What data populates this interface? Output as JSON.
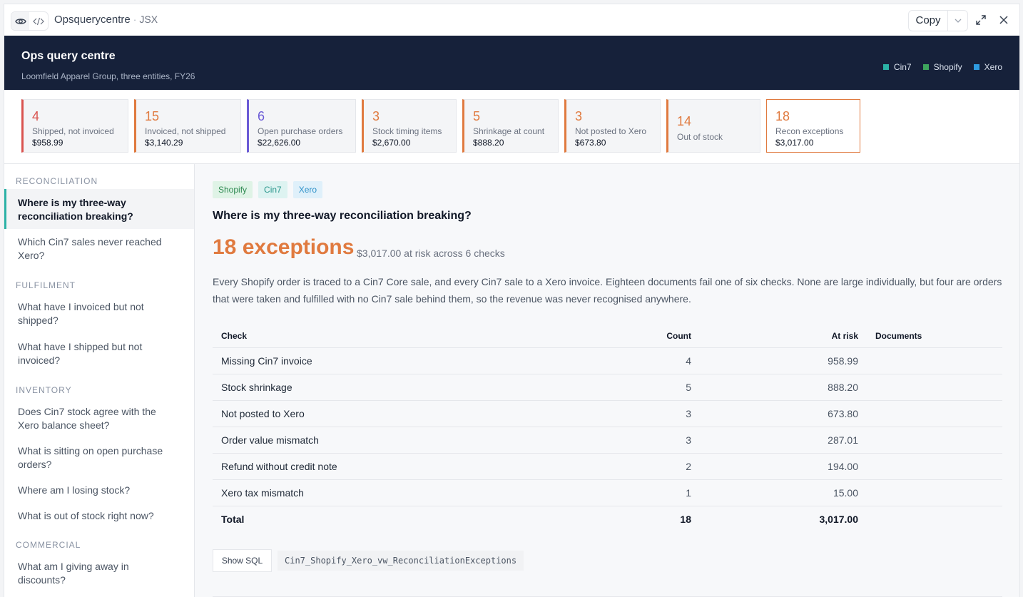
{
  "toolbar": {
    "title": "Opsquerycentre",
    "separator": "·",
    "lang": "JSX",
    "copy_label": "Copy"
  },
  "header": {
    "title": "Ops query centre",
    "subtitle": "Loomfield Apparel Group, three entities, FY26",
    "legend": [
      {
        "label": "Cin7",
        "color": "#2bb2a6"
      },
      {
        "label": "Shopify",
        "color": "#3ea55d"
      },
      {
        "label": "Xero",
        "color": "#2e9be0"
      }
    ]
  },
  "kpis": [
    {
      "count": "4",
      "label": "Shipped, not invoiced",
      "amount": "$958.99",
      "color": "#d9534f"
    },
    {
      "count": "15",
      "label": "Invoiced, not shipped",
      "amount": "$3,140.29",
      "color": "#e07a3f"
    },
    {
      "count": "6",
      "label": "Open purchase orders",
      "amount": "$22,626.00",
      "color": "#6b5bd6"
    },
    {
      "count": "3",
      "label": "Stock timing items",
      "amount": "$2,670.00",
      "color": "#e07a3f"
    },
    {
      "count": "5",
      "label": "Shrinkage at count",
      "amount": "$888.20",
      "color": "#e07a3f"
    },
    {
      "count": "3",
      "label": "Not posted to Xero",
      "amount": "$673.80",
      "color": "#e07a3f"
    },
    {
      "count": "14",
      "label": "Out of stock",
      "amount": "",
      "color": "#e07a3f"
    },
    {
      "count": "18",
      "label": "Recon exceptions",
      "amount": "$3,017.00",
      "color": "#e07a3f"
    }
  ],
  "sidebar": {
    "sections": [
      {
        "title": "RECONCILIATION",
        "items": [
          "Where is my three-way reconciliation breaking?",
          "Which Cin7 sales never reached Xero?"
        ]
      },
      {
        "title": "FULFILMENT",
        "items": [
          "What have I invoiced but not shipped?",
          "What have I shipped but not invoiced?"
        ]
      },
      {
        "title": "INVENTORY",
        "items": [
          "Does Cin7 stock agree with the Xero balance sheet?",
          "What is sitting on open purchase orders?",
          "Where am I losing stock?",
          "What is out of stock right now?"
        ]
      },
      {
        "title": "COMMERCIAL",
        "items": [
          "What am I giving away in discounts?"
        ]
      }
    ]
  },
  "main": {
    "tags": [
      "Shopify",
      "Cin7",
      "Xero"
    ],
    "question": "Where is my three-way reconciliation breaking?",
    "headline": "18 exceptions",
    "risk": "$3,017.00 at risk across 6 checks",
    "paragraph": "Every Shopify order is traced to a Cin7 Core sale, and every Cin7 sale to a Xero invoice. Eighteen documents fail one of six checks. None are large individually, but four are orders that were taken and fulfilled with no Cin7 sale behind them, so the revenue was never recognised anywhere.",
    "table": {
      "headers": [
        "Check",
        "Count",
        "At risk",
        "Documents"
      ],
      "rows": [
        {
          "check": "Missing Cin7 invoice",
          "count": "4",
          "risk": "958.99",
          "docs": ""
        },
        {
          "check": "Stock shrinkage",
          "count": "5",
          "risk": "888.20",
          "docs": ""
        },
        {
          "check": "Not posted to Xero",
          "count": "3",
          "risk": "673.80",
          "docs": ""
        },
        {
          "check": "Order value mismatch",
          "count": "3",
          "risk": "287.01",
          "docs": ""
        },
        {
          "check": "Refund without credit note",
          "count": "2",
          "risk": "194.00",
          "docs": ""
        },
        {
          "check": "Xero tax mismatch",
          "count": "1",
          "risk": "15.00",
          "docs": ""
        }
      ],
      "total": {
        "label": "Total",
        "count": "18",
        "risk": "3,017.00"
      }
    },
    "sql_button": "Show SQL",
    "sql_view": "Cin7_Shopify_Xero_vw_ReconciliationExceptions"
  }
}
